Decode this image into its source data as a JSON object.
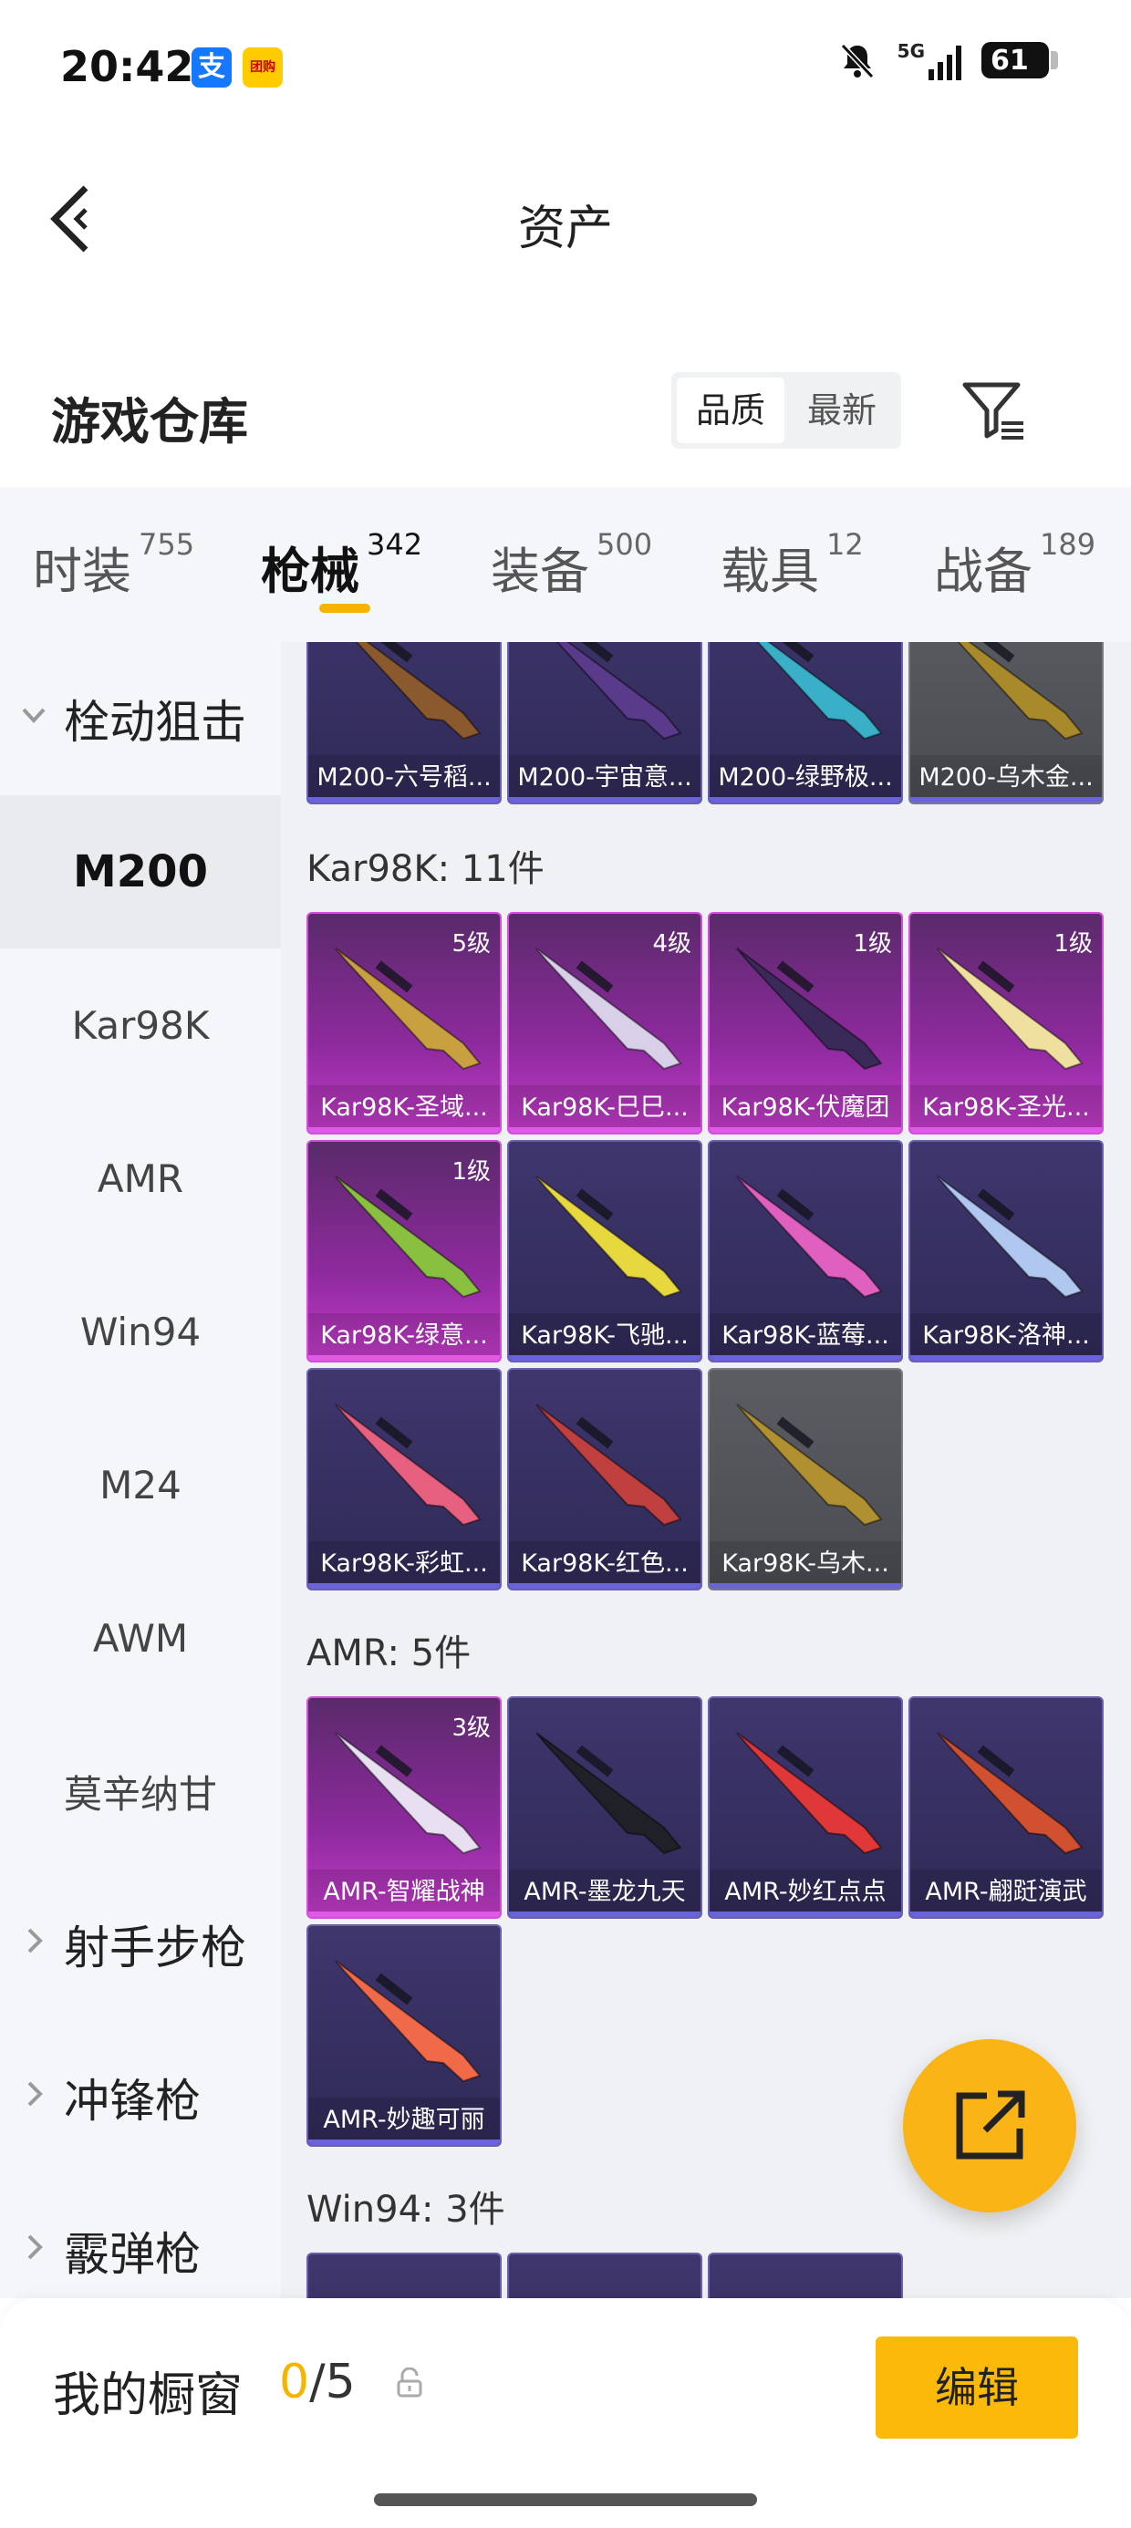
{
  "status_bar": {
    "time": "20:42",
    "app_icons": [
      "支",
      "团购"
    ],
    "signal_text": "5G",
    "battery": "61"
  },
  "nav": {
    "back_icon": "chevron-left-icon",
    "title": "资产"
  },
  "header": {
    "title": "游戏仓库",
    "sort_options": [
      "品质",
      "最新"
    ],
    "selected_sort": "品质",
    "filter_icon": "filter-icon"
  },
  "tabs": [
    {
      "label": "时装",
      "count": "755"
    },
    {
      "label": "枪械",
      "count": "342"
    },
    {
      "label": "装备",
      "count": "500"
    },
    {
      "label": "载具",
      "count": "12"
    },
    {
      "label": "战备",
      "count": "189"
    }
  ],
  "active_tab": "枪械",
  "sidebar": {
    "group_open": "栓动狙击",
    "items": [
      "M200",
      "Kar98K",
      "AMR",
      "Win94",
      "M24",
      "AWM",
      "莫辛纳甘"
    ],
    "active_item": "M200",
    "groups_closed": [
      "射手步枪",
      "冲锋枪",
      "霰弹枪"
    ]
  },
  "sections": {
    "m200_cards": [
      {
        "name": "M200-六号稻...",
        "style": "purple",
        "gun_color": "#8a5a2e"
      },
      {
        "name": "M200-宇宙意...",
        "style": "purple",
        "gun_color": "#5a3a8a"
      },
      {
        "name": "M200-绿野极...",
        "style": "purple",
        "gun_color": "#3ab0c8"
      },
      {
        "name": "M200-乌木金...",
        "style": "gray",
        "gun_color": "#a88a2a"
      }
    ],
    "kar98k_title": "Kar98K: 11件",
    "kar98k_cards": [
      {
        "name": "Kar98K-圣域...",
        "style": "pink",
        "level": "5级",
        "gun_color": "#c8a040"
      },
      {
        "name": "Kar98K-巳巳...",
        "style": "pink",
        "level": "4级",
        "gun_color": "#d8d0e8"
      },
      {
        "name": "Kar98K-伏魔团",
        "style": "pink",
        "level": "1级",
        "gun_color": "#3a2a5a"
      },
      {
        "name": "Kar98K-圣光...",
        "style": "pink",
        "level": "1级",
        "gun_color": "#f0e0a0"
      },
      {
        "name": "Kar98K-绿意...",
        "style": "pink",
        "level": "1级",
        "gun_color": "#8ac040"
      },
      {
        "name": "Kar98K-飞驰...",
        "style": "purple",
        "level": "",
        "gun_color": "#e8d840"
      },
      {
        "name": "Kar98K-蓝莓...",
        "style": "purple",
        "level": "",
        "gun_color": "#e060c0"
      },
      {
        "name": "Kar98K-洛神...",
        "style": "purple",
        "level": "",
        "gun_color": "#b0c8f0"
      },
      {
        "name": "Kar98K-彩虹...",
        "style": "purple",
        "level": "",
        "gun_color": "#e86080"
      },
      {
        "name": "Kar98K-红色...",
        "style": "purple",
        "level": "",
        "gun_color": "#c04040"
      },
      {
        "name": "Kar98K-乌木...",
        "style": "gray",
        "level": "",
        "gun_color": "#b09030"
      }
    ],
    "amr_title": "AMR: 5件",
    "amr_cards": [
      {
        "name": "AMR-智耀战神",
        "style": "pink",
        "level": "3级",
        "gun_color": "#e8e0f0"
      },
      {
        "name": "AMR-墨龙九天",
        "style": "purple",
        "level": "",
        "gun_color": "#202028"
      },
      {
        "name": "AMR-妙红点点",
        "style": "purple",
        "level": "",
        "gun_color": "#e03838"
      },
      {
        "name": "AMR-翩跹演武",
        "style": "purple",
        "level": "",
        "gun_color": "#d05030"
      },
      {
        "name": "AMR-妙趣可丽",
        "style": "purple",
        "level": "",
        "gun_color": "#f06a4a"
      }
    ],
    "win94_title": "Win94: 3件"
  },
  "fab": {
    "icon": "external-link-icon"
  },
  "bottom": {
    "label": "我的橱窗",
    "count_current": "0",
    "count_total": "/5",
    "lock_icon": "lock-icon",
    "edit_label": "编辑"
  },
  "colors": {
    "accent": "#fbb415",
    "tab_underline": "#f5b400"
  }
}
